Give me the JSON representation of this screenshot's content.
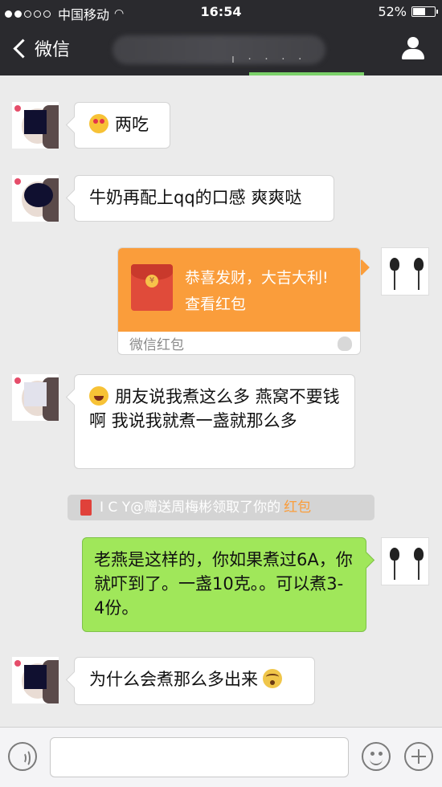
{
  "status_bar": {
    "signal_dots_filled": 2,
    "signal_dots_total": 5,
    "carrier": "中国移动",
    "time": "16:54",
    "battery_percent": "52%",
    "battery_level": 0.52
  },
  "nav": {
    "back_label": "微信",
    "title_visible_fragment": "ı  · · · ·"
  },
  "messages": [
    {
      "side": "left",
      "text": "两吃",
      "leading_emoji": "heart-eyes-emoji-icon"
    },
    {
      "side": "left",
      "text": "牛奶再配上qq的口感 爽爽哒"
    },
    {
      "side": "right",
      "type": "red_packet",
      "greeting": "恭喜发财，大吉大利!",
      "action": "查看红包",
      "footer": "微信红包"
    },
    {
      "side": "left",
      "text": "朋友说我煮这么多 燕窝不要钱啊 我说我就煮一盏就那么多",
      "leading_emoji": "laughing-tears-emoji-icon"
    },
    {
      "side": "right",
      "text": "老燕是这样的，你如果煮过6A，你就吓到了。一盏10克。。可以煮3-4份。"
    },
    {
      "side": "left",
      "text": "为什么会煮那么多出来",
      "trailing_emoji": "flushed-emoji-icon"
    }
  ],
  "system_notice": {
    "text": "I C Y@赠送周梅彬领取了你的",
    "link": "红包"
  },
  "colors": {
    "nav_bg": "#2a2a2e",
    "chat_bg": "#ebebeb",
    "sent_bubble": "#a0e75a",
    "red_packet": "#fa9d3b"
  }
}
